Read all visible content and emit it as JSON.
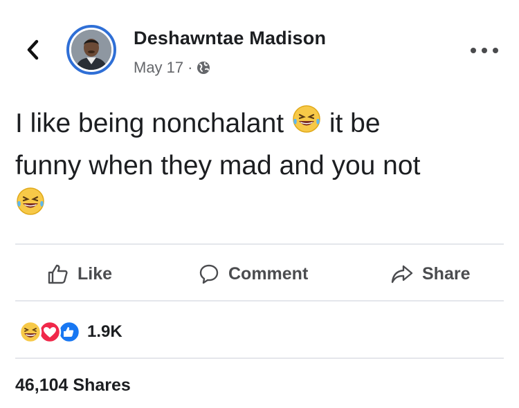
{
  "post": {
    "author": "Deshawntae Madison",
    "date": "May 17",
    "separator": "·",
    "privacy_icon": "globe-icon",
    "text_line1a": "I like being nonchalant",
    "text_line1b": "it be",
    "text_line2": "funny when they mad and you not",
    "emoji": "face-with-tears-of-joy"
  },
  "actions": {
    "like_label": "Like",
    "comment_label": "Comment",
    "share_label": "Share"
  },
  "reactions": {
    "types": [
      "haha",
      "love",
      "like"
    ],
    "count": "1.9K"
  },
  "shares": "46,104 Shares",
  "colors": {
    "accent_blue": "#2f6fd6",
    "love_red": "#f0284a",
    "emoji_yellow": "#f7c948",
    "text_dark": "#1c1e21",
    "text_muted": "#65676b",
    "divider": "#e4e6eb"
  }
}
